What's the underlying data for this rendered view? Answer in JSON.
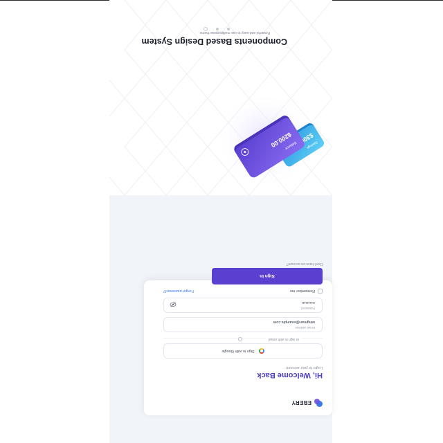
{
  "brand": {
    "name": "EBERY"
  },
  "login": {
    "welcome_title": "Hi, Welcome Back",
    "subtitle": "Login to your account",
    "google_label": "Sign in with Google",
    "divider_text": "or sign in with email",
    "email": {
      "label": "Email address",
      "value": "wingman@example.com"
    },
    "password": {
      "label": "Password",
      "value": "••••••••••"
    },
    "remember_label": "Remember me",
    "forgot_label": "Forgot password?",
    "signin_label": "Sign In",
    "signup_prompt": "Don't have an account?",
    "signup_link": ""
  },
  "hero": {
    "title": "Components Based Design System",
    "subtitle": "Powerful and easy to use multipurpose theme.",
    "carousel": {
      "count": 3,
      "active_index": 0
    },
    "cards": {
      "purple": {
        "label": "Balance",
        "amount": "$200.00"
      },
      "blue": {
        "label": "Savings",
        "amount": "$300"
      }
    }
  },
  "colors": {
    "primary": "#5b3fd0",
    "accent_blue": "#3b7ae8",
    "panel_bg": "#f1f4f8",
    "card_purple": "#6d4fe0",
    "card_blue": "#2fa8e8"
  },
  "icons": [
    "google-icon",
    "eye-icon",
    "brand-logo-icon"
  ]
}
